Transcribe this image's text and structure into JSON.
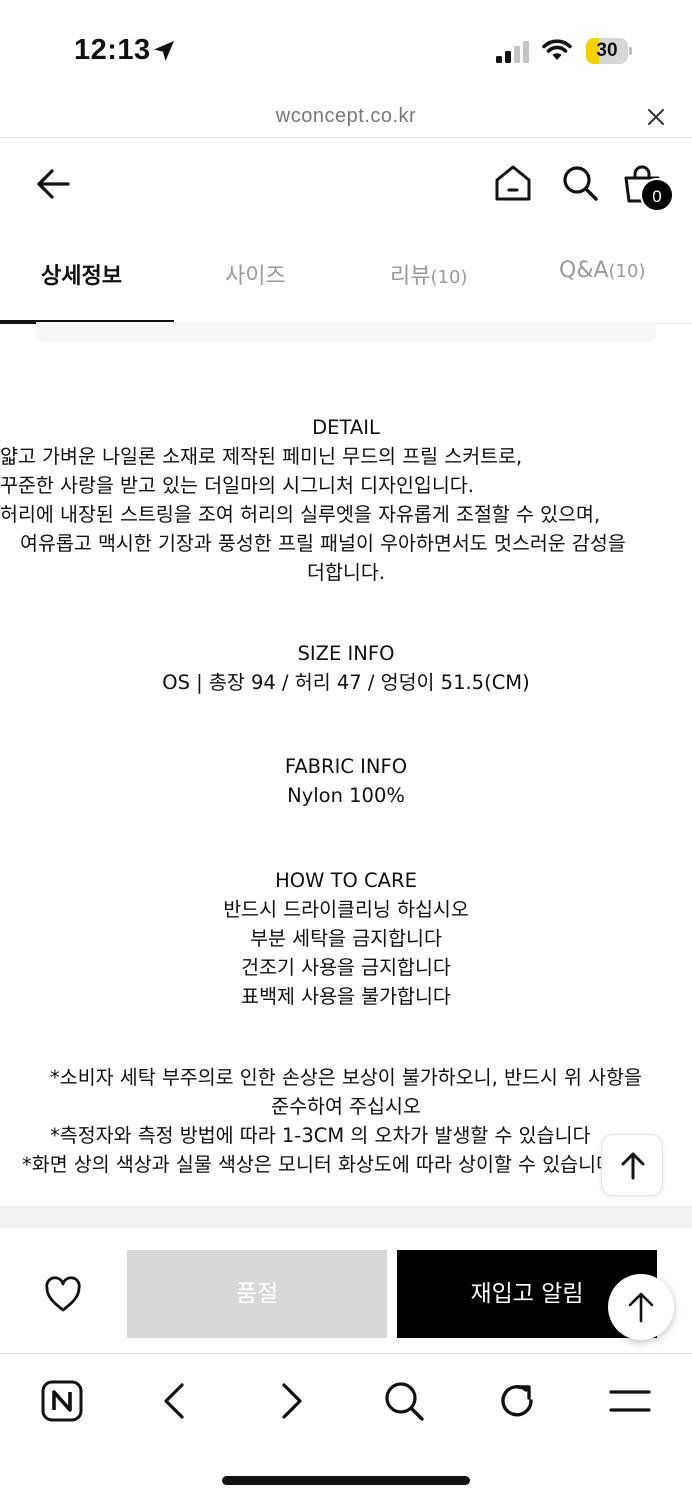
{
  "status_bar": {
    "time": "12:13",
    "battery_level": "30",
    "battery_fraction": 0.3
  },
  "url_bar": {
    "url": "wconcept.co.kr"
  },
  "header": {
    "cart_count": "0"
  },
  "tabs": [
    {
      "label": "상세정보",
      "count": "",
      "active": true
    },
    {
      "label": "사이즈",
      "count": "",
      "active": false
    },
    {
      "label": "리뷰",
      "count": "(10)",
      "active": false
    },
    {
      "label": "Q&A",
      "count": "(10)",
      "active": false
    }
  ],
  "detail": {
    "title": "DETAIL",
    "lines": [
      "얇고 가벼운 나일론 소재로 제작된 페미닌 무드의 프릴 스커트로,",
      "꾸준한 사랑을 받고 있는 더일마의 시그니처 디자인입니다.",
      "허리에 내장된 스트링을 조여 허리의 실루엣을 자유롭게 조절할 수 있으며,",
      "여유롭고 맥시한 기장과 풍성한 프릴 패널이 우아하면서도 멋스러운 감성을",
      "더합니다."
    ]
  },
  "size_info": {
    "title": "SIZE INFO",
    "text": "OS | 총장 94 / 허리 47 / 엉덩이 51.5(CM)"
  },
  "fabric_info": {
    "title": "FABRIC INFO",
    "text": "Nylon 100%"
  },
  "care": {
    "title": "HOW TO CARE",
    "lines": [
      "반드시 드라이클리닝 하십시오",
      "부분 세탁을 금지합니다",
      "건조기 사용을 금지합니다",
      "표백제 사용을 불가합니다"
    ]
  },
  "notes": [
    "*소비자 세탁 부주의로 인한 손상은 보상이 불가하오니, 반드시 위 사항을",
    "준수하여 주십시오",
    "*측정자와 측정 방법에 따라 1-3CM 의 오차가 발생할 수 있습니다",
    "*화면 상의 색상과 실물 색상은 모니터 화상도에 따라 상이할 수 있습니다"
  ],
  "actions": {
    "soldout_label": "품절",
    "restock_label": "재입고 알림"
  },
  "icons": {
    "location": "location-arrow-icon",
    "signal": "signal-icon",
    "wifi": "wifi-icon",
    "close": "close-icon",
    "back": "back-arrow-icon",
    "home": "home-icon",
    "search": "search-icon",
    "bag": "shopping-bag-icon",
    "heart": "heart-icon",
    "up": "arrow-up-icon",
    "naver": "naver-n-icon",
    "prev": "chevron-left-icon",
    "next": "chevron-right-icon",
    "reload": "reload-icon",
    "menu": "menu-icon"
  },
  "colors": {
    "accent": "#000000",
    "soldout_bg": "#d8d8d8",
    "battery": "#f5d000"
  }
}
